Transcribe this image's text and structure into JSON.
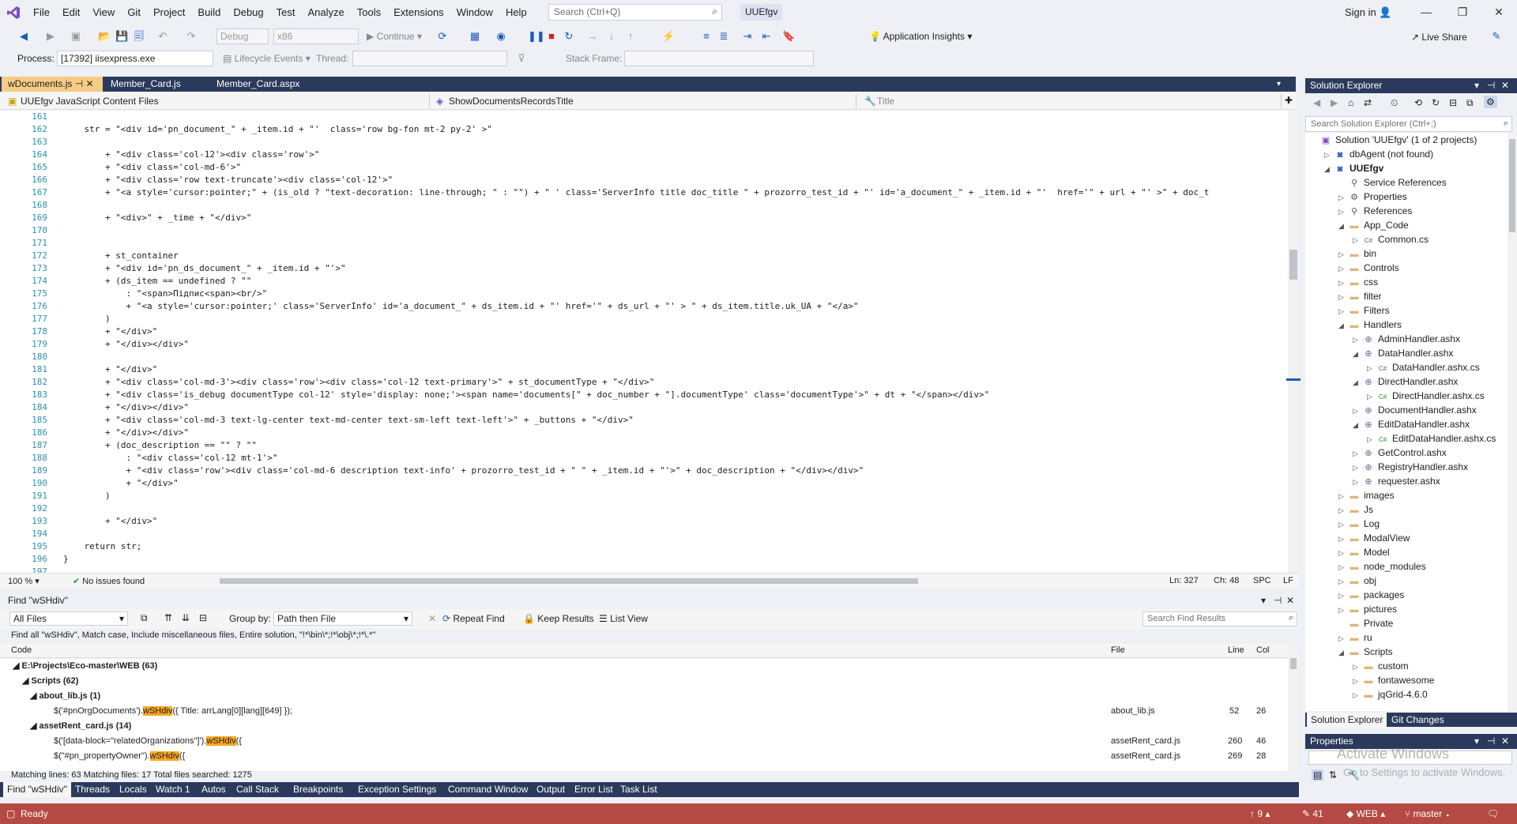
{
  "menubar": {
    "items": [
      "File",
      "Edit",
      "View",
      "Git",
      "Project",
      "Build",
      "Debug",
      "Test",
      "Analyze",
      "Tools",
      "Extensions",
      "Window",
      "Help"
    ],
    "search_placeholder": "Search (Ctrl+Q)",
    "window_title": "UUEfgv",
    "sign_in": "Sign in"
  },
  "toolbar": {
    "config": "Debug",
    "platform": "x86",
    "continue_label": "Continue",
    "app_insights": "Application Insights",
    "live_share": "Live Share",
    "process_label": "Process:",
    "process_value": "[17392] iisexpress.exe",
    "lifecycle_label": "Lifecycle Events",
    "thread_label": "Thread:",
    "stack_frame_label": "Stack Frame:"
  },
  "editor": {
    "tabs": [
      "wDocuments.js",
      "Member_Card.js",
      "Member_Card.aspx"
    ],
    "nav_project": "UUEfgv JavaScript Content Files",
    "nav_member": "ShowDocumentsRecordsTitle",
    "nav_title": "Title",
    "zoom": "100 %",
    "issues": "No issues found",
    "position": "Ln: 327",
    "char": "Ch: 48",
    "spc": "SPC",
    "eol": "LF",
    "lines": [
      {
        "n": "161",
        "t": ""
      },
      {
        "n": "162",
        "t": "    str = \"<div id='pn_document_\" + _item.id + \"'  class='row bg-fon mt-2 py-2' >\""
      },
      {
        "n": "163",
        "t": ""
      },
      {
        "n": "164",
        "t": "        + \"<div class='col-12'><div class='row'>\""
      },
      {
        "n": "165",
        "t": "        + \"<div class='col-md-6'>\""
      },
      {
        "n": "166",
        "t": "        + \"<div class='row text-truncate'><div class='col-12'>\""
      },
      {
        "n": "167",
        "t": "        + \"<a style='cursor:pointer;\" + (is_old ? \"text-decoration: line-through; \" : \"\") + \" ' class='ServerInfo title doc_title \" + prozorro_test_id + \"' id='a_document_\" + _item.id + \"'  href='\" + url + \"' >\" + doc_t"
      },
      {
        "n": "168",
        "t": ""
      },
      {
        "n": "169",
        "t": "        + \"<div>\" + _time + \"</div>\""
      },
      {
        "n": "170",
        "t": ""
      },
      {
        "n": "171",
        "t": ""
      },
      {
        "n": "172",
        "t": "        + st_container"
      },
      {
        "n": "173",
        "t": "        + \"<div id='pn_ds_document_\" + _item.id + \"'>\""
      },
      {
        "n": "174",
        "t": "        + (ds_item == undefined ? \"\""
      },
      {
        "n": "175",
        "t": "            : \"<span>Підпис<span><br/>\""
      },
      {
        "n": "176",
        "t": "            + \"<a style='cursor:pointer;' class='ServerInfo' id='a_document_\" + ds_item.id + \"' href='\" + ds_url + \"' > \" + ds_item.title.uk_UA + \"</a>\""
      },
      {
        "n": "177",
        "t": "        )"
      },
      {
        "n": "178",
        "t": "        + \"</div>\""
      },
      {
        "n": "179",
        "t": "        + \"</div></div>\""
      },
      {
        "n": "180",
        "t": ""
      },
      {
        "n": "181",
        "t": "        + \"</div>\""
      },
      {
        "n": "182",
        "t": "        + \"<div class='col-md-3'><div class='row'><div class='col-12 text-primary'>\" + st_documentType + \"</div>\""
      },
      {
        "n": "183",
        "t": "        + \"<div class='is_debug documentType col-12' style='display: none;'><span name='documents[\" + doc_number + \"].documentType' class='documentType'>\" + dt + \"</span></div>\""
      },
      {
        "n": "184",
        "t": "        + \"</div></div>\""
      },
      {
        "n": "185",
        "t": "        + \"<div class='col-md-3 text-lg-center text-md-center text-sm-left text-left'>\" + _buttons + \"</div>\""
      },
      {
        "n": "186",
        "t": "        + \"</div></div>\""
      },
      {
        "n": "187",
        "t": "        + (doc_description == \"\" ? \"\""
      },
      {
        "n": "188",
        "t": "            : \"<div class='col-12 mt-1'>\""
      },
      {
        "n": "189",
        "t": "            + \"<div class='row'><div class='col-md-6 description text-info' + prozorro_test_id + \" \" + _item.id + \"'>\" + doc_description + \"</div></div>\""
      },
      {
        "n": "190",
        "t": "            + \"</div>\""
      },
      {
        "n": "191",
        "t": "        )"
      },
      {
        "n": "192",
        "t": ""
      },
      {
        "n": "193",
        "t": "        + \"</div>\""
      },
      {
        "n": "194",
        "t": ""
      },
      {
        "n": "195",
        "t": "    return str;"
      },
      {
        "n": "196",
        "t": "}"
      },
      {
        "n": "197",
        "t": ""
      }
    ]
  },
  "find": {
    "title": "Find \"wSHdiv\"",
    "scope": "All Files",
    "group_by_label": "Group by:",
    "group_by_value": "Path then File",
    "repeat_find": "Repeat Find",
    "keep_results": "Keep Results",
    "list_view": "List View",
    "search_placeholder": "Search Find Results",
    "summary": "Find all \"wSHdiv\", Match case, Include miscellaneous files, Entire solution, \"!*\\bin\\*;!*\\obj\\*;!*\\.*\"",
    "col_code": "Code",
    "col_file": "File",
    "col_line": "Line",
    "col_col": "Col",
    "group_root": "E:\\Projects\\Eco-master\\WEB (63)",
    "group_scripts": "Scripts (62)",
    "file1": "about_lib.js (1)",
    "r1_pre": "$('#pnOrgDocuments').",
    "r1_hl": "wSHdiv",
    "r1_post": "({ Title: arrLang[0][lang][649] });",
    "r1_file": "about_lib.js",
    "r1_line": "52",
    "r1_col": "26",
    "file2": "assetRent_card.js (14)",
    "r2_pre": "$('[data-block=\"relatedOrganizations\"]').",
    "r2_hl": "wSHdiv",
    "r2_post": "({",
    "r2_file": "assetRent_card.js",
    "r2_line": "260",
    "r2_col": "46",
    "r3_pre": "$(\"#pn_propertyOwner\").",
    "r3_hl": "wSHdiv",
    "r3_post": "({",
    "r3_file": "assetRent_card.js",
    "r3_line": "269",
    "r3_col": "28",
    "footer": "Matching lines: 63 Matching files: 17 Total files searched: 1275"
  },
  "bottom_tabs": [
    "Find \"wSHdiv\"",
    "Threads",
    "Locals",
    "Watch 1",
    "Autos",
    "Call Stack",
    "Breakpoints",
    "Exception Settings",
    "Command Window",
    "Output",
    "Error List",
    "Task List"
  ],
  "solution_explorer": {
    "title": "Solution Explorer",
    "search_placeholder": "Search Solution Explorer (Ctrl+;)",
    "tabs": [
      "Solution Explorer",
      "Git Changes"
    ],
    "nodes": [
      {
        "label": "Solution 'UUEfgv' (1 of 2 projects)",
        "depth": 0,
        "exp": "",
        "icon": "sln"
      },
      {
        "label": "dbAgent (not found)",
        "depth": 1,
        "exp": "▷",
        "icon": "proj"
      },
      {
        "label": "UUEfgv",
        "depth": 1,
        "exp": "◢",
        "icon": "proj"
      },
      {
        "label": "Service References",
        "depth": 2,
        "exp": "",
        "icon": "ref"
      },
      {
        "label": "Properties",
        "depth": 2,
        "exp": "▷",
        "icon": "gear"
      },
      {
        "label": "References",
        "depth": 2,
        "exp": "▷",
        "icon": "ref"
      },
      {
        "label": "App_Code",
        "depth": 2,
        "exp": "◢",
        "icon": "folder"
      },
      {
        "label": "Common.cs",
        "depth": 3,
        "exp": "▷",
        "icon": "cs"
      },
      {
        "label": "bin",
        "depth": 2,
        "exp": "▷",
        "icon": "folder"
      },
      {
        "label": "Controls",
        "depth": 2,
        "exp": "▷",
        "icon": "folder"
      },
      {
        "label": "css",
        "depth": 2,
        "exp": "▷",
        "icon": "folder"
      },
      {
        "label": "filter",
        "depth": 2,
        "exp": "▷",
        "icon": "folder"
      },
      {
        "label": "Filters",
        "depth": 2,
        "exp": "▷",
        "icon": "folder"
      },
      {
        "label": "Handlers",
        "depth": 2,
        "exp": "◢",
        "icon": "folder"
      },
      {
        "label": "AdminHandler.ashx",
        "depth": 3,
        "exp": "▷",
        "icon": "file"
      },
      {
        "label": "DataHandler.ashx",
        "depth": 3,
        "exp": "◢",
        "icon": "file"
      },
      {
        "label": "DataHandler.ashx.cs",
        "depth": 4,
        "exp": "▷",
        "icon": "cs"
      },
      {
        "label": "DirectHandler.ashx",
        "depth": 3,
        "exp": "◢",
        "icon": "file"
      },
      {
        "label": "DirectHandler.ashx.cs",
        "depth": 4,
        "exp": "▷",
        "icon": "cs"
      },
      {
        "label": "DocumentHandler.ashx",
        "depth": 3,
        "exp": "▷",
        "icon": "file"
      },
      {
        "label": "EditDataHandler.ashx",
        "depth": 3,
        "exp": "◢",
        "icon": "file"
      },
      {
        "label": "EditDataHandler.ashx.cs",
        "depth": 4,
        "exp": "▷",
        "icon": "cs"
      },
      {
        "label": "GetControl.ashx",
        "depth": 3,
        "exp": "▷",
        "icon": "file"
      },
      {
        "label": "RegistryHandler.ashx",
        "depth": 3,
        "exp": "▷",
        "icon": "file"
      },
      {
        "label": "requester.ashx",
        "depth": 3,
        "exp": "▷",
        "icon": "file"
      },
      {
        "label": "images",
        "depth": 2,
        "exp": "▷",
        "icon": "folder"
      },
      {
        "label": "Js",
        "depth": 2,
        "exp": "▷",
        "icon": "folder"
      },
      {
        "label": "Log",
        "depth": 2,
        "exp": "▷",
        "icon": "folder"
      },
      {
        "label": "ModalView",
        "depth": 2,
        "exp": "▷",
        "icon": "folder"
      },
      {
        "label": "Model",
        "depth": 2,
        "exp": "▷",
        "icon": "folder"
      },
      {
        "label": "node_modules",
        "depth": 2,
        "exp": "▷",
        "icon": "folder"
      },
      {
        "label": "obj",
        "depth": 2,
        "exp": "▷",
        "icon": "folder"
      },
      {
        "label": "packages",
        "depth": 2,
        "exp": "▷",
        "icon": "folder"
      },
      {
        "label": "pictures",
        "depth": 2,
        "exp": "▷",
        "icon": "folder"
      },
      {
        "label": "Private",
        "depth": 2,
        "exp": "",
        "icon": "folder"
      },
      {
        "label": "ru",
        "depth": 2,
        "exp": "▷",
        "icon": "folder"
      },
      {
        "label": "Scripts",
        "depth": 2,
        "exp": "◢",
        "icon": "folder"
      },
      {
        "label": "custom",
        "depth": 3,
        "exp": "▷",
        "icon": "folder"
      },
      {
        "label": "fontawesome",
        "depth": 3,
        "exp": "▷",
        "icon": "folder"
      },
      {
        "label": "jqGrid-4.6.0",
        "depth": 3,
        "exp": "▷",
        "icon": "folder"
      }
    ]
  },
  "properties": {
    "title": "Properties",
    "watermark": "Activate Windows",
    "watermark_sub": "Go to Settings to activate Windows."
  },
  "statusbar": {
    "ready": "Ready",
    "up": "9",
    "pencil": "41",
    "repo": "WEB",
    "branch": "master"
  },
  "colors": {
    "accent": "#2b3a5c",
    "status": "#b44a43",
    "highlight": "#f7a723",
    "tab_active": "#f5cc84"
  }
}
